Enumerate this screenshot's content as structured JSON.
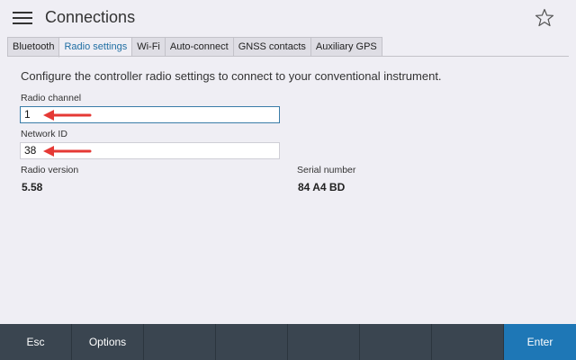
{
  "header": {
    "title": "Connections"
  },
  "tabs": [
    {
      "label": "Bluetooth"
    },
    {
      "label": "Radio settings"
    },
    {
      "label": "Wi-Fi"
    },
    {
      "label": "Auto-connect"
    },
    {
      "label": "GNSS contacts"
    },
    {
      "label": "Auxiliary GPS"
    }
  ],
  "active_tab": "Radio settings",
  "content": {
    "description": "Configure the controller radio settings to connect to your conventional instrument.",
    "radio_channel": {
      "label": "Radio channel",
      "value": "1"
    },
    "network_id": {
      "label": "Network ID",
      "value": "38"
    },
    "radio_version": {
      "label": "Radio version",
      "value": "5.58"
    },
    "serial_number": {
      "label": "Serial number",
      "value": "84 A4 BD"
    }
  },
  "bottom_bar": {
    "esc": "Esc",
    "options": "Options",
    "enter": "Enter"
  },
  "colors": {
    "accent": "#1e77b6",
    "bar": "#3a4550",
    "arrow": "#e53935"
  },
  "icons": {
    "menu": "hamburger-menu-icon",
    "favorite": "star-outline-icon",
    "annotation": "red-arrow-icon"
  }
}
